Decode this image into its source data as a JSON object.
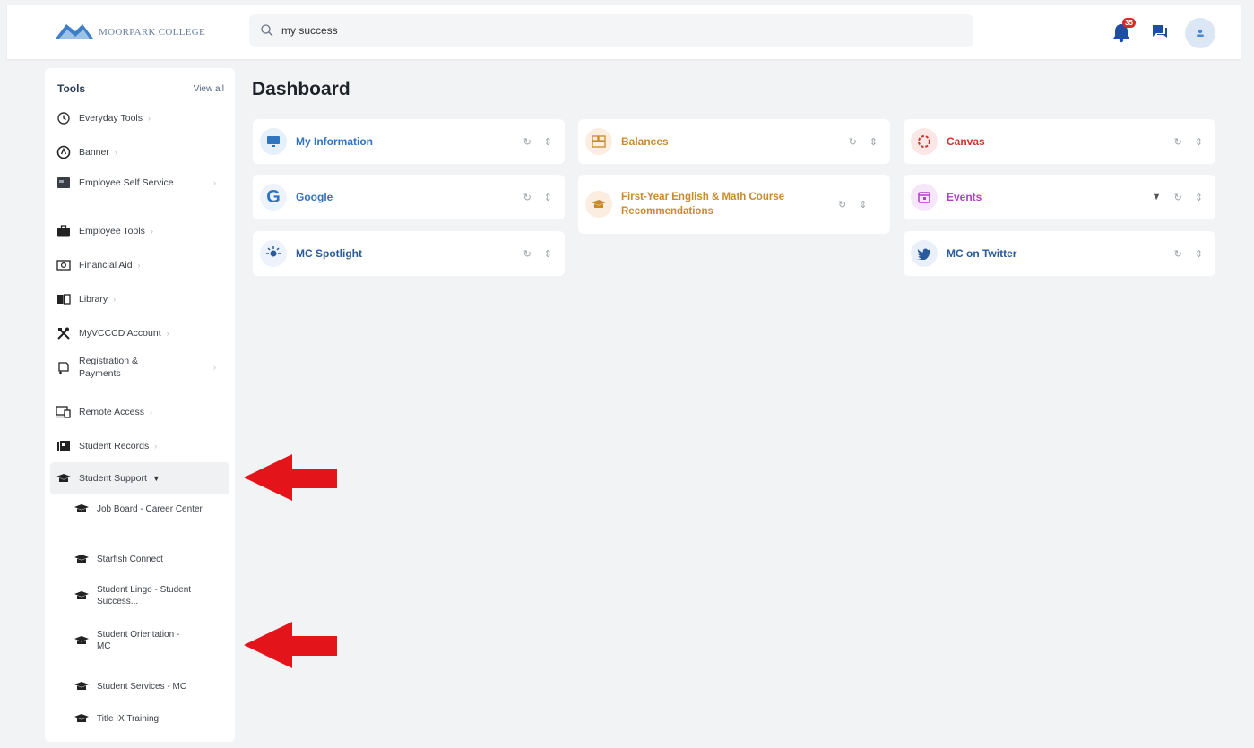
{
  "header": {
    "logo_text": "MOORPARK COLLEGE",
    "search_value": "my success",
    "notification_count": "35"
  },
  "sidebar": {
    "title": "Tools",
    "view_all": "View all",
    "items": [
      {
        "label": "Everyday Tools",
        "icon": "history-icon"
      },
      {
        "label": "Banner",
        "icon": "banner-icon"
      },
      {
        "label": "Employee Self Service",
        "icon": "employee-self-service-icon"
      },
      {
        "label": "Employee Tools",
        "icon": "briefcase-icon"
      },
      {
        "label": "Financial Aid",
        "icon": "money-icon"
      },
      {
        "label": "Library",
        "icon": "book-icon"
      },
      {
        "label": "MyVCCCD Account",
        "icon": "tools-icon"
      },
      {
        "label": "Registration & Payments",
        "icon": "registration-icon"
      },
      {
        "label": "Remote Access",
        "icon": "remote-desktop-icon"
      },
      {
        "label": "Student Records",
        "icon": "records-icon"
      },
      {
        "label": "Student Support",
        "icon": "graduation-cap-icon"
      }
    ],
    "subitems": [
      {
        "label": "Job Board - Career Center"
      },
      {
        "label": "Starfish Connect"
      },
      {
        "label": "Student Lingo - Student Success..."
      },
      {
        "label": "Student Orientation - MC"
      },
      {
        "label": "Student Services - MC"
      },
      {
        "label": "Title IX Training"
      }
    ]
  },
  "main": {
    "title": "Dashboard",
    "cards": [
      {
        "title": "My Information",
        "color": "#2f74c0"
      },
      {
        "title": "Google",
        "color": "#2f74c0"
      },
      {
        "title": "MC Spotlight",
        "color": "#2b5a9a"
      },
      {
        "title": "Balances",
        "color": "#c98a2c"
      },
      {
        "title": "First-Year English & Math Course Recommendations",
        "color": "#c98a2c"
      },
      {
        "title": "Canvas",
        "color": "#c8372f"
      },
      {
        "title": "Events",
        "color": "#b03ec6"
      },
      {
        "title": "MC on Twitter",
        "color": "#2b5a9a"
      }
    ]
  },
  "annotations": {
    "arrow_color": "#e3151a"
  }
}
